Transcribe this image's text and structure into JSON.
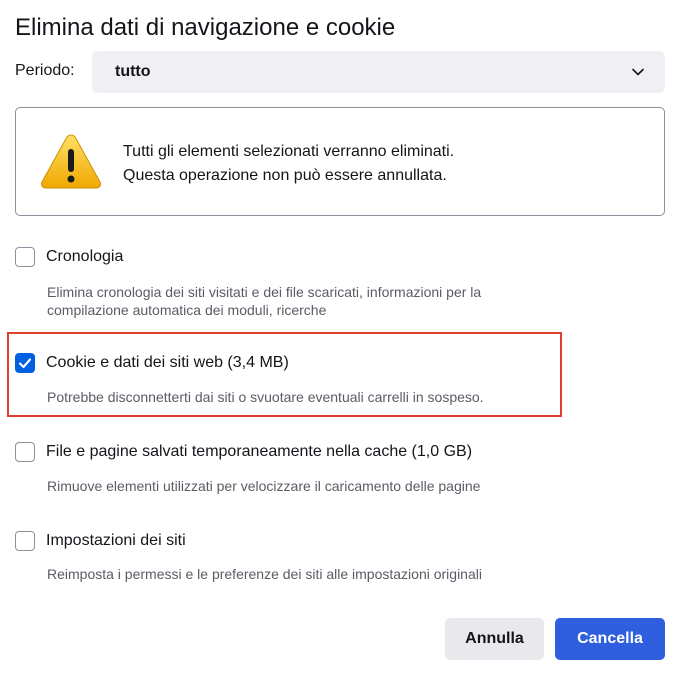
{
  "dialog": {
    "title": "Elimina dati di navigazione e cookie"
  },
  "period": {
    "label": "Periodo:",
    "selected": "tutto",
    "icon": "chevron-down-icon"
  },
  "warning": {
    "icon": "warning-triangle-icon",
    "line1": "Tutti gli elementi selezionati verranno eliminati.",
    "line2": "Questa operazione non può essere annullata."
  },
  "options": [
    {
      "label": "Cronologia",
      "description_line1": "Elimina cronologia dei siti visitati e dei file scaricati, informazioni per la",
      "description_line2": "compilazione automatica dei moduli, ricerche",
      "checked": false
    },
    {
      "label": "Cookie e dati dei siti web (3,4 MB)",
      "description_line1": "Potrebbe disconnetterti dai siti o svuotare eventuali carrelli in sospeso.",
      "checked": true
    },
    {
      "label": "File e pagine salvati temporaneamente nella cache (1,0 GB)",
      "description_line1": "Rimuove elementi utilizzati per velocizzare il caricamento delle pagine",
      "checked": false
    },
    {
      "label": "Impostazioni dei siti",
      "description_line1": "Reimposta i permessi e le preferenze dei siti alle impostazioni originali",
      "checked": false
    }
  ],
  "buttons": {
    "cancel": "Annulla",
    "clear": "Cancella"
  },
  "colors": {
    "accent": "#2f5fdf",
    "checkbox_checked": "#0061e0",
    "highlight": "#e0412f",
    "warning_yellow": "#f5c518"
  }
}
